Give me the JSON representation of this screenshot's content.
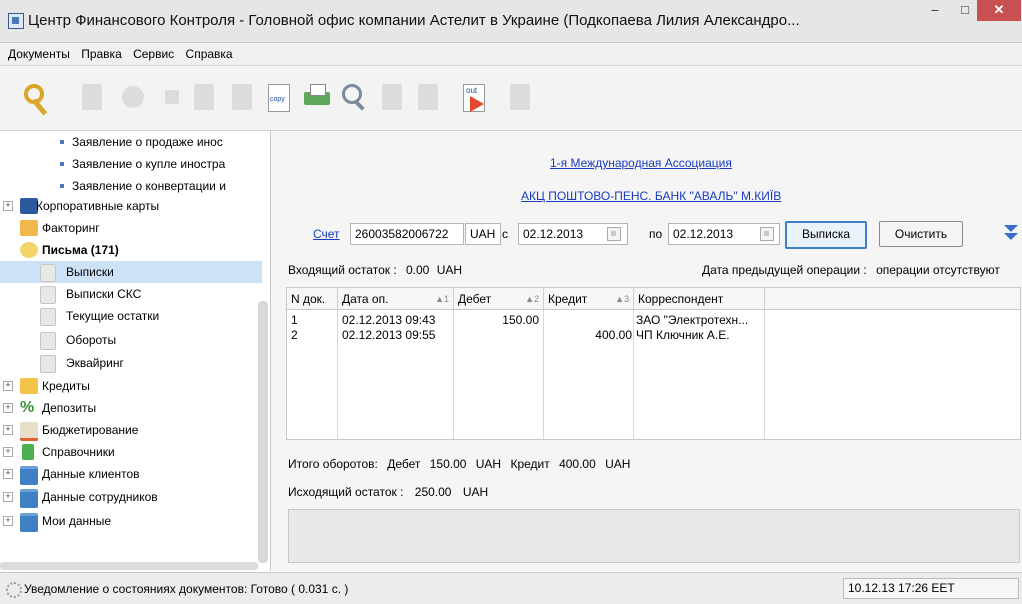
{
  "window": {
    "title": "Центр Финансового Контроля - Головной офис компании Астелит в Украине (Подкопаева Лилия Александро...",
    "minimize": "–",
    "maximize": "□",
    "close": "✕"
  },
  "menu": [
    "Документы",
    "Правка",
    "Сервис",
    "Справка"
  ],
  "toolbar": {
    "copy_label": "copy",
    "out_label": "out"
  },
  "sidebar": {
    "sub_items": [
      "Заявление о продаже инос",
      "Заявление о купле иностра",
      "Заявление о конвертации и"
    ],
    "items": [
      {
        "label": "Корпоративные карты",
        "expander": "+"
      },
      {
        "label": "Факторинг"
      },
      {
        "label": "Письма (171)"
      },
      {
        "label": "Выписки"
      },
      {
        "label": "Выписки СКС"
      },
      {
        "label": "Текущие остатки"
      },
      {
        "label": "Обороты"
      },
      {
        "label": "Эквайринг"
      },
      {
        "label": "Кредиты",
        "expander": "+"
      },
      {
        "label": "Депозиты",
        "expander": "+"
      },
      {
        "label": "Бюджетирование",
        "expander": "+"
      },
      {
        "label": "Справочники",
        "expander": "+"
      },
      {
        "label": "Данные клиентов",
        "expander": "+"
      },
      {
        "label": "Данные сотрудников",
        "expander": "+"
      },
      {
        "label": "Мои данные",
        "expander": "+"
      }
    ]
  },
  "main": {
    "association_link": "1-я Международная Ассоциация",
    "bank_link": "АКЦ ПОШТОВО-ПЕНС. БАНК \"АВАЛЬ\" М.КИЇВ",
    "account_label": "Счет",
    "account_number": "26003582006722",
    "currency": "UAH",
    "from_label": "с",
    "date_from": "02.12.2013",
    "to_label": "по",
    "date_to": "02.12.2013",
    "statement_button": "Выписка",
    "clear_button": "Очистить",
    "incoming_label": "Входящий остаток :",
    "incoming_value": "0.00",
    "incoming_currency": "UAH",
    "prev_op_label": "Дата предыдущей операции :",
    "prev_op_value": "операции отсутствуют",
    "columns": [
      {
        "label": "N док.",
        "sort": ""
      },
      {
        "label": "Дата оп.",
        "sort": "▲1"
      },
      {
        "label": "Дебет",
        "sort": "▲2"
      },
      {
        "label": "Кредит",
        "sort": "▲3"
      },
      {
        "label": "Корреспондент",
        "sort": ""
      }
    ],
    "rows": [
      {
        "n": "1",
        "date": "02.12.2013 09:43",
        "debit": "150.00",
        "credit": "",
        "corr": "ЗАО \"Электротехн..."
      },
      {
        "n": "2",
        "date": "02.12.2013 09:55",
        "debit": "",
        "credit": "400.00",
        "corr": "ЧП Ключник А.Е."
      }
    ],
    "totals_label": "Итого оборотов:",
    "totals_debit_label": "Дебет",
    "totals_debit": "150.00",
    "totals_debit_cur": "UAH",
    "totals_credit_label": "Кредит",
    "totals_credit": "400.00",
    "totals_credit_cur": "UAH",
    "outgoing_label": "Исходящий остаток :",
    "outgoing_value": "250.00",
    "outgoing_currency": "UAH"
  },
  "status": {
    "message": "Уведомление о состояниях документов: Готово ( 0.031 с. )",
    "datetime": "10.12.13 17:26 EET"
  }
}
